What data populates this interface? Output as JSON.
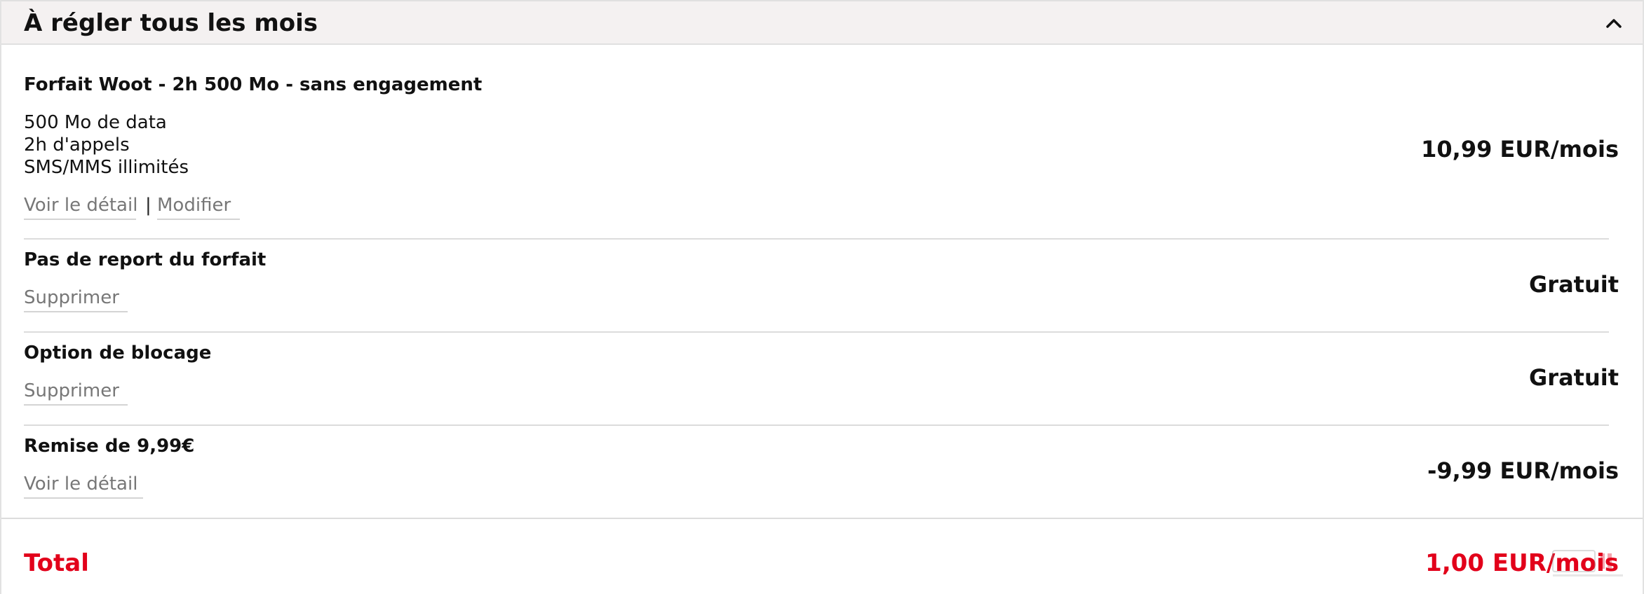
{
  "section": {
    "title": "À régler tous les mois",
    "collapse_icon": "chevron-up-icon"
  },
  "items": [
    {
      "title": "Forfait Woot - 2h 500 Mo - sans engagement",
      "features": [
        "500 Mo de data",
        "2h d'appels",
        "SMS/MMS illimités"
      ],
      "links": [
        "Voir le détail",
        "Modifier"
      ],
      "separator": "|",
      "price": "10,99 EUR/mois"
    },
    {
      "title": "Pas de report du forfait",
      "links": [
        "Supprimer"
      ],
      "price": "Gratuit"
    },
    {
      "title": "Option de blocage",
      "links": [
        "Supprimer"
      ],
      "price": "Gratuit"
    },
    {
      "title": "Remise de 9,99€",
      "links": [
        "Voir le détail"
      ],
      "price": "-9,99 EUR/mois"
    }
  ],
  "total": {
    "label": "Total",
    "value": "1,00 EUR/mois"
  },
  "colors": {
    "accent": "#e2001a",
    "header_bg": "#f4f1f1",
    "link": "#777777"
  }
}
